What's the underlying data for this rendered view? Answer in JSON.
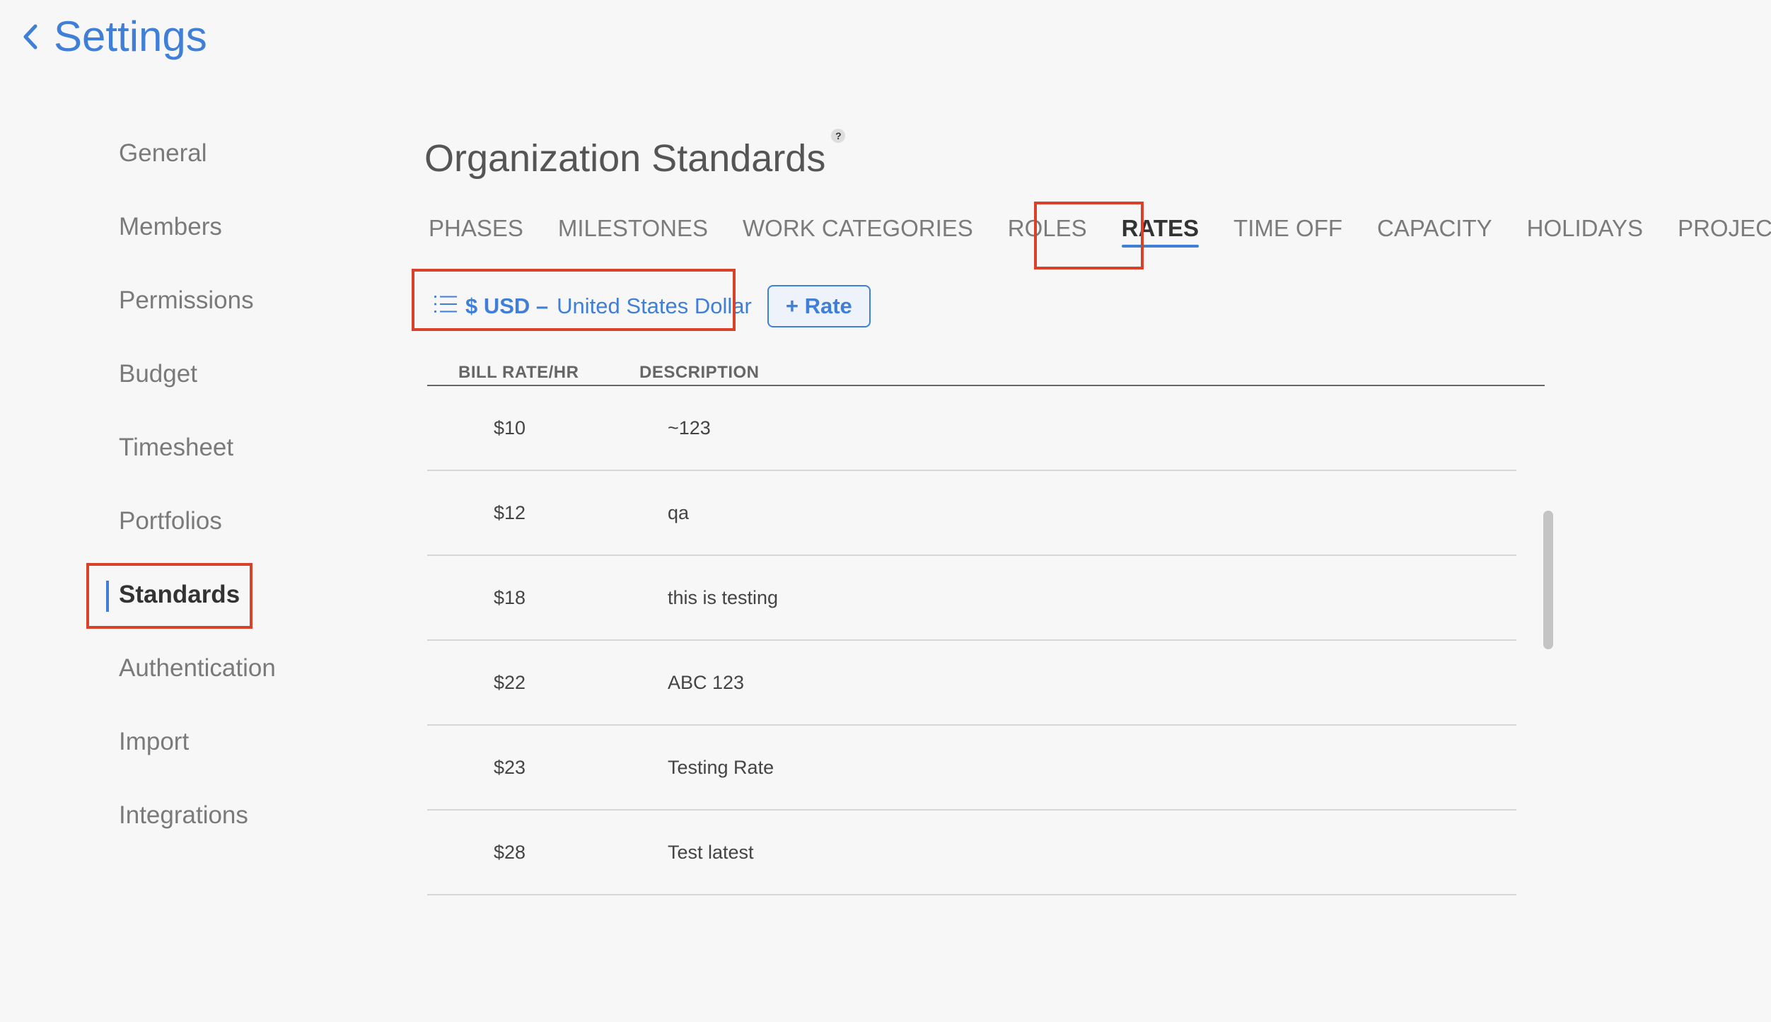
{
  "header": {
    "back_label": "Settings"
  },
  "sidebar": {
    "items": [
      {
        "label": "General"
      },
      {
        "label": "Members"
      },
      {
        "label": "Permissions"
      },
      {
        "label": "Budget"
      },
      {
        "label": "Timesheet"
      },
      {
        "label": "Portfolios"
      },
      {
        "label": "Standards",
        "active": true
      },
      {
        "label": "Authentication"
      },
      {
        "label": "Import"
      },
      {
        "label": "Integrations"
      }
    ]
  },
  "main": {
    "title": "Organization Standards",
    "help_label": "?",
    "tabs": [
      {
        "label": "PHASES"
      },
      {
        "label": "MILESTONES"
      },
      {
        "label": "WORK CATEGORIES"
      },
      {
        "label": "ROLES"
      },
      {
        "label": "RATES",
        "active": true
      },
      {
        "label": "TIME OFF"
      },
      {
        "label": "CAPACITY"
      },
      {
        "label": "HOLIDAYS"
      },
      {
        "label": "PROJECTS"
      }
    ],
    "currency": {
      "code": "$ USD –",
      "name": "United States Dollar"
    },
    "add_rate_label": "+ Rate",
    "table": {
      "columns": [
        "BILL RATE/HR",
        "DESCRIPTION"
      ],
      "rows": [
        {
          "rate": "$10",
          "description": "~123"
        },
        {
          "rate": "$12",
          "description": "qa"
        },
        {
          "rate": "$18",
          "description": "this is testing"
        },
        {
          "rate": "$22",
          "description": "ABC 123"
        },
        {
          "rate": "$23",
          "description": "Testing Rate"
        },
        {
          "rate": "$28",
          "description": "Test latest"
        }
      ]
    }
  },
  "colors": {
    "accent": "#3f7fd8",
    "highlight": "#d9412b",
    "background": "#f7f7f7"
  }
}
